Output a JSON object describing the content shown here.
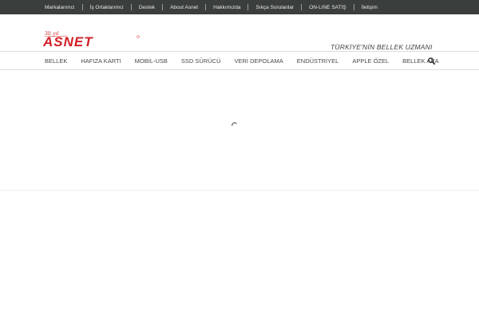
{
  "topbar": {
    "links": [
      "Markalarımız",
      "İş Ortaklarımız",
      "Destek",
      "About Asnet",
      "Hakkımızda",
      "Sıkça Sorulanlar",
      "ON-LINE SATIŞ",
      "İletişim"
    ]
  },
  "header": {
    "logo_text": "ASNET",
    "logo_badge": "30. yıl",
    "tagline": "TÜRKİYE'NİN BELLEK UZMANI"
  },
  "nav": {
    "items": [
      "BELLEK",
      "HAFIZA KARTI",
      "MOBİL-USB",
      "SSD SÜRÜCÜ",
      "VERİ DEPOLAMA",
      "ENDÜSTRİYEL",
      "APPLE ÖZEL",
      "BELLEK ARA"
    ],
    "search_icon": "search-icon"
  },
  "colors": {
    "topbar_bg": "#3a3f3d",
    "brand_red": "#d21f26"
  }
}
